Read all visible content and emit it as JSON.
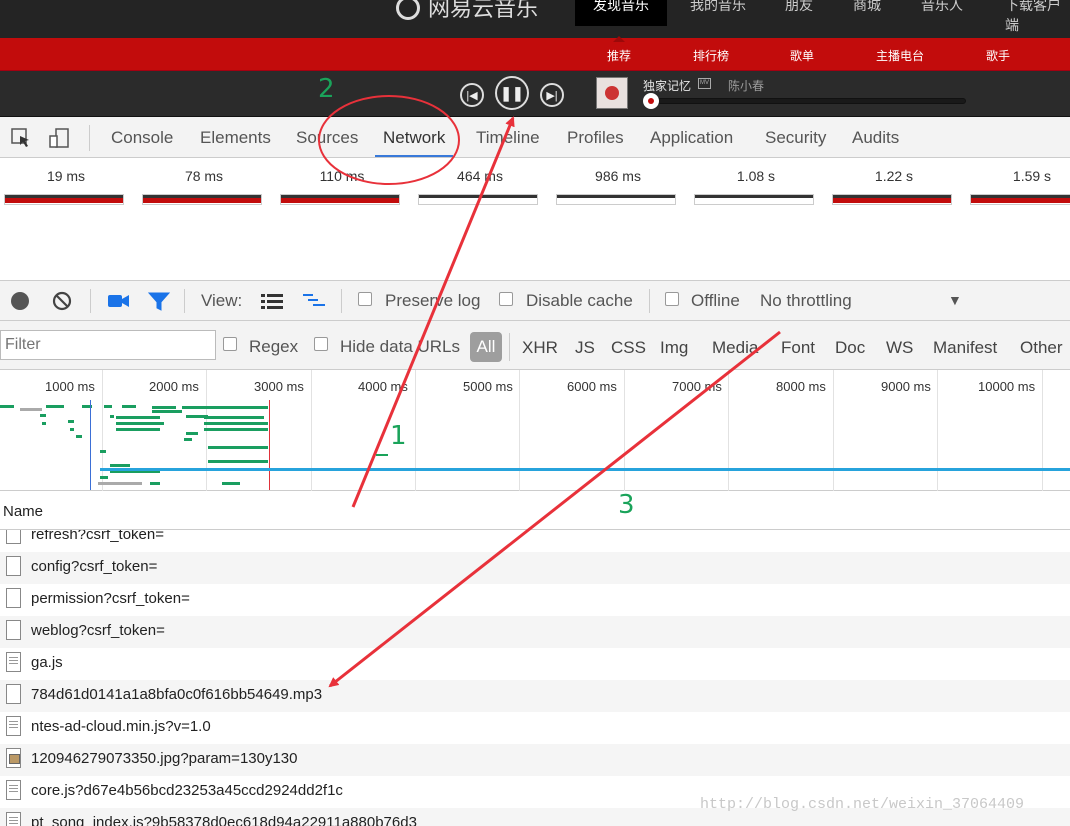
{
  "netease": {
    "logo_text": "网易云音乐",
    "nav": [
      "发现音乐",
      "我的音乐",
      "朋友",
      "商城",
      "音乐人",
      "下载客户端"
    ],
    "subnav": [
      "推荐",
      "排行榜",
      "歌单",
      "主播电台",
      "歌手"
    ],
    "player": {
      "song": "独家记忆",
      "artist": "陈小春",
      "mv_badge": "MV"
    }
  },
  "devtools": {
    "tabs": [
      "Console",
      "Elements",
      "Sources",
      "Network",
      "Timeline",
      "Profiles",
      "Application",
      "Security",
      "Audits"
    ],
    "filmstrip": [
      "19 ms",
      "78 ms",
      "110 ms",
      "464 ms",
      "986 ms",
      "1.08 s",
      "1.22 s",
      "1.59 s"
    ],
    "toolbar": {
      "view_label": "View:",
      "preserve_log": "Preserve log",
      "disable_cache": "Disable cache",
      "offline": "Offline",
      "throttling": "No throttling"
    },
    "filter": {
      "placeholder": "Filter",
      "regex": "Regex",
      "hide_data_urls": "Hide data URLs",
      "types": [
        "All",
        "XHR",
        "JS",
        "CSS",
        "Img",
        "Media",
        "Font",
        "Doc",
        "WS",
        "Manifest",
        "Other"
      ]
    },
    "overview_ticks": [
      "1000 ms",
      "2000 ms",
      "3000 ms",
      "4000 ms",
      "5000 ms",
      "6000 ms",
      "7000 ms",
      "8000 ms",
      "9000 ms",
      "10000 ms"
    ],
    "name_header": "Name",
    "requests": [
      "refresh?csrf_token=",
      "config?csrf_token=",
      "permission?csrf_token=",
      "weblog?csrf_token=",
      "ga.js",
      "784d61d0141a1a8bfa0c0f616bb54649.mp3",
      "ntes-ad-cloud.min.js?v=1.0",
      "120946279073350.jpg?param=130y130",
      "core.js?d67e4b56bcd23253a45ccd2924dd2f1c",
      "pt_song_index.js?9b58378d0ec618d94a22911a880b76d3"
    ]
  },
  "annotations": {
    "a1": "1",
    "a2": "2",
    "a3": "3"
  },
  "watermark": "http://blog.csdn.net/weixin_37064409",
  "colors": {
    "netease_red": "#c20c0c",
    "annotation_red": "#e8313a",
    "annotation_green": "#1aa35a",
    "devtools_blue": "#3879d9"
  }
}
